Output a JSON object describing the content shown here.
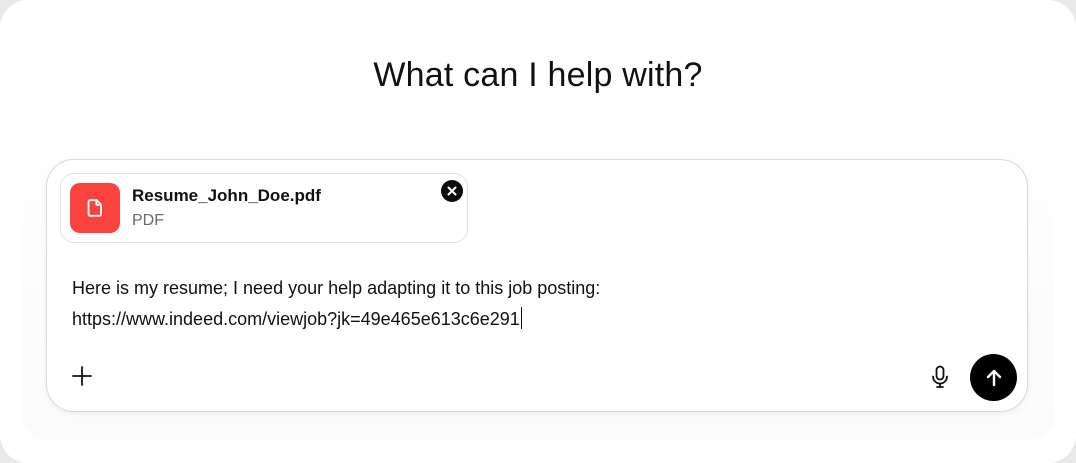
{
  "heading": "What can I help with?",
  "attachment": {
    "file_name": "Resume_John_Doe.pdf",
    "file_type": "PDF",
    "icon": "document-icon",
    "icon_bg_color": "#fa423e",
    "remove_icon": "close-icon"
  },
  "composer": {
    "message_lines": [
      "Here is my resume; I need your help adapting it to this job posting:",
      "https://www.indeed.com/viewjob?jk=49e465e613c6e291"
    ],
    "add_icon": "plus-icon",
    "voice_icon": "microphone-icon",
    "send_icon": "arrow-up-icon",
    "send_bg_color": "#000000"
  }
}
